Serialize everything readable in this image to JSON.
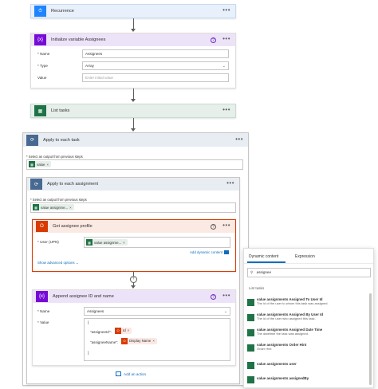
{
  "recurrence": {
    "title": "Recurrence"
  },
  "init_var": {
    "title": "Initialize variable Assignees",
    "name_label": "* Name",
    "name_value": "Assignees",
    "type_label": "* Type",
    "type_value": "Array",
    "value_label": "Value",
    "value_placeholder": "Enter initial value"
  },
  "list_tasks": {
    "title": "List tasks"
  },
  "apply_outer": {
    "title": "Apply to each task",
    "select_label": "* Select an output from previous steps",
    "token": "value"
  },
  "apply_inner": {
    "title": "Apply to each assignment",
    "select_label": "* Select an output from previous steps",
    "token": "value assignme..."
  },
  "get_profile": {
    "title": "Get assignee profile",
    "user_label": "* User (UPN)",
    "token": "value assignme...",
    "add_dynamic": "Add dynamic content",
    "show_advanced": "Show advanced options"
  },
  "append": {
    "title": "Append assignee ID and name",
    "name_label": "* Name",
    "name_value": "Assignees",
    "value_label": "* Value",
    "line_open": "{",
    "line_id_key": "\"assigneeId\":",
    "id_token": "Id",
    "line_name_key": "\"assigneeName\":",
    "name_token": "Display Name",
    "line_close": "}"
  },
  "add_action": "Add an action",
  "dynamic_panel": {
    "tab_dynamic": "Dynamic content",
    "tab_expression": "Expression",
    "search_value": "assignee",
    "section": "List tasks",
    "items": [
      {
        "title": "value assignments Assigned To User Id",
        "desc": "The id of the user to whom this task was assigned."
      },
      {
        "title": "value assignments Assigned By User Id",
        "desc": "The id of the user who assigned this task."
      },
      {
        "title": "value assignments Assigned Date Time",
        "desc": "The datetime the task was assigned."
      },
      {
        "title": "value assignments Order Hint",
        "desc": "Order Hint"
      },
      {
        "title": "value assignments user",
        "desc": ""
      },
      {
        "title": "value assignments assignedBy",
        "desc": ""
      }
    ]
  },
  "colors": {
    "recurrence": "#1f85ff",
    "variable": "#770bd6",
    "planner": "#1f7346",
    "control": "#486991",
    "office": "#d83b01"
  }
}
